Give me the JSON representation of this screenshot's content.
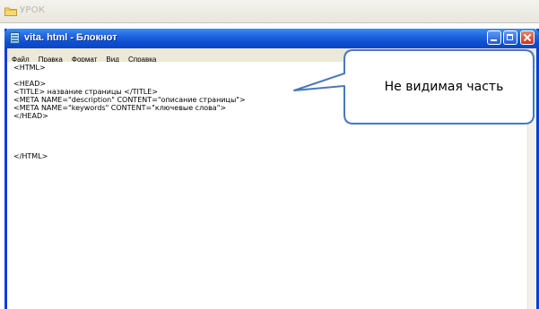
{
  "outer": {
    "title": "УРОК",
    "folder_icon": "folder-icon"
  },
  "window": {
    "title": "vita. html - Блокнот",
    "app_icon": "notepad-icon",
    "controls": [
      "minimize-icon",
      "maximize-icon",
      "close-icon"
    ]
  },
  "menu": {
    "items": [
      {
        "label": "Файл"
      },
      {
        "label": "Правка"
      },
      {
        "label": "Формат"
      },
      {
        "label": "Вид"
      },
      {
        "label": "Справка"
      }
    ]
  },
  "editor": {
    "lines": [
      "<HTML>",
      "",
      "<HEAD>",
      "<TITLE> название страницы </TITLE>",
      "<META NAME=\"description\" CONTENT=\"описание страницы\">",
      "<META NAME=\"keywords\" CONTENT=\"ключевые слова\">",
      "</HEAD>",
      "",
      "",
      "",
      "</HTML>"
    ]
  },
  "callout": {
    "text": "Не видимая часть"
  },
  "colors": {
    "titlebar": "#0b46c2",
    "border": "#0a3fd8",
    "callout_border": "#4a78b8"
  }
}
